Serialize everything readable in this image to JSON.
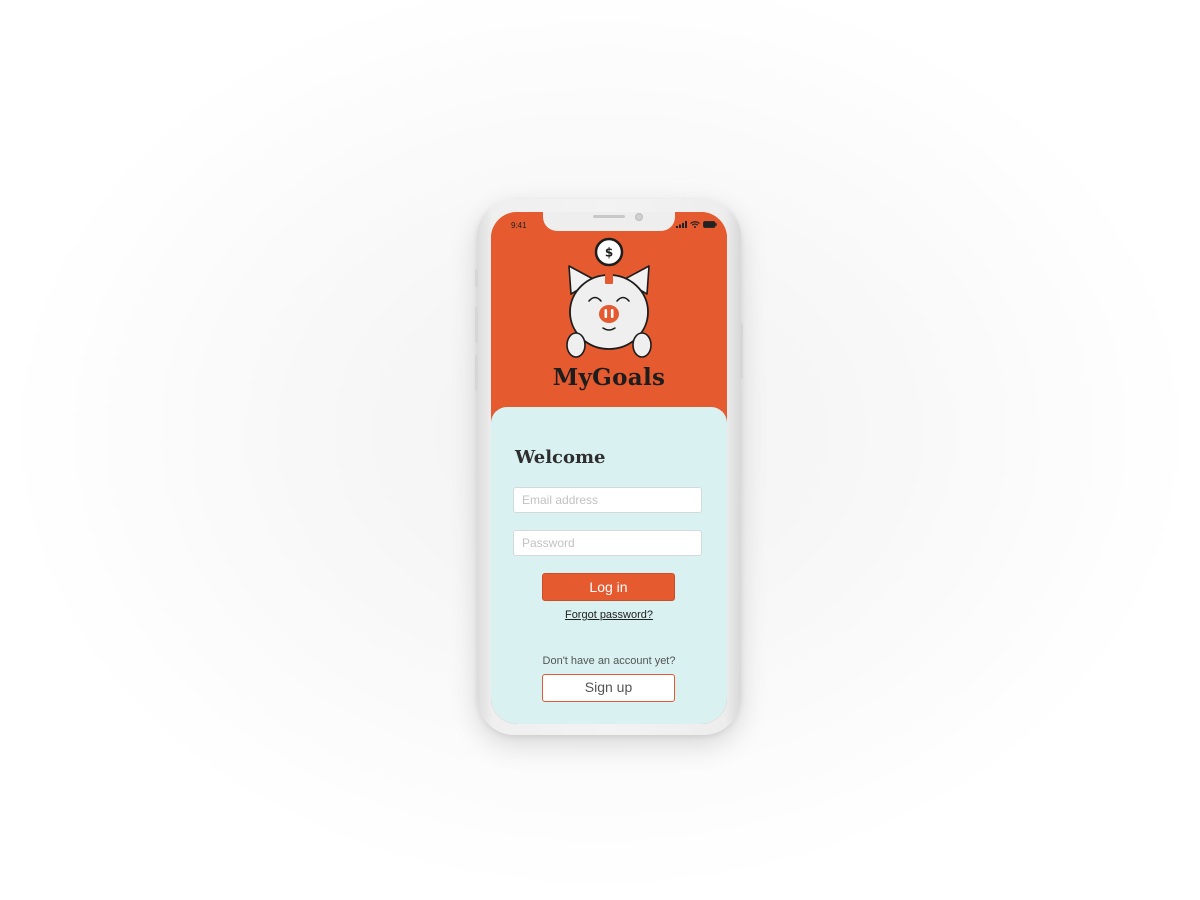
{
  "status_bar": {
    "time": "9:41"
  },
  "app": {
    "name": "MyGoals",
    "logo_icon": "piggy-bank-icon",
    "coin_symbol": "$"
  },
  "login": {
    "heading": "Welcome",
    "email_placeholder": "Email address",
    "password_placeholder": "Password",
    "login_label": "Log in",
    "forgot_label": "Forgot password?",
    "no_account_text": "Don't have an account yet?",
    "signup_label": "Sign up"
  },
  "colors": {
    "brand_orange": "#e55a2f",
    "card_background": "#d9f1f1",
    "text_dark": "#2e2e2e"
  }
}
